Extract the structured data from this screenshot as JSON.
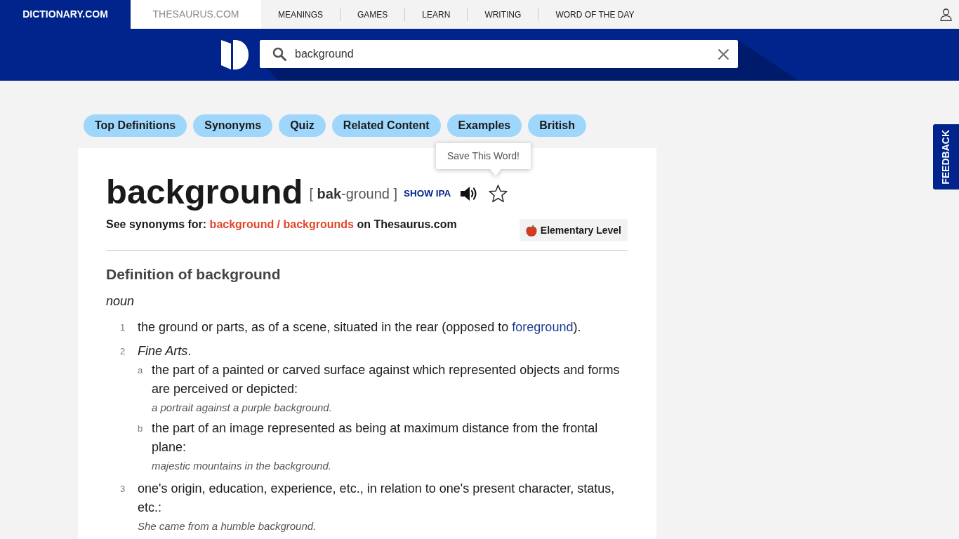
{
  "top_nav": {
    "sites": [
      {
        "label": "DICTIONARY.COM",
        "selected": true
      },
      {
        "label": "THESAURUS.COM",
        "selected": false
      }
    ],
    "links": [
      "MEANINGS",
      "GAMES",
      "LEARN",
      "WRITING",
      "WORD OF THE DAY"
    ]
  },
  "search": {
    "value": "background"
  },
  "section_tabs": [
    "Top Definitions",
    "Synonyms",
    "Quiz",
    "Related Content",
    "Examples",
    "British"
  ],
  "tooltip": "Save This Word!",
  "entry": {
    "headword": "background",
    "pronunciation": "[ **bak**-ground ]",
    "show_ipa": "SHOW IPA",
    "synonyms": {
      "prefix": "See synonyms for:",
      "link": "background / backgrounds",
      "suffix": "on Thesaurus.com"
    },
    "level_badge": "Elementary Level"
  },
  "definitions": {
    "title": "Definition of background",
    "part_of_speech": "noun",
    "senses": [
      {
        "number": "1",
        "parts": [
          {
            "kind": "text",
            "text": "the ground or parts, as of a scene, situated in the rear (opposed to "
          },
          {
            "kind": "link",
            "text": "foreground"
          },
          {
            "kind": "text",
            "text": ")."
          }
        ]
      },
      {
        "number": "2",
        "label": "*Fine Arts*.",
        "subsenses": [
          {
            "letter": "a",
            "text": "the part of a painted or carved surface against which represented objects and forms are perceived or depicted:",
            "example": "a portrait against a purple background."
          },
          {
            "letter": "b",
            "text": "the part of an image represented as being at maximum distance from the frontal plane:",
            "example": "majestic mountains in the background."
          }
        ]
      },
      {
        "number": "3",
        "parts": [
          {
            "kind": "text",
            "text": "one's origin, education, experience, etc., in relation to one's present character, status, etc.:"
          }
        ],
        "example": "She came from a humble background."
      }
    ]
  },
  "feedback": "FEEDBACK"
}
